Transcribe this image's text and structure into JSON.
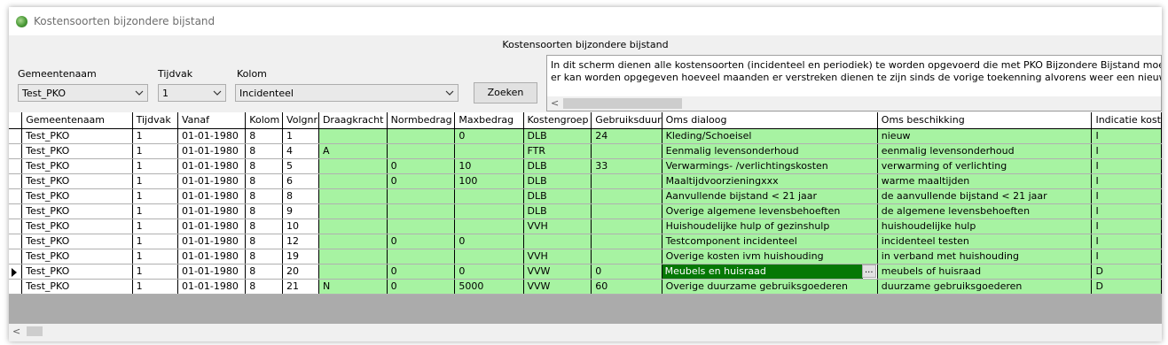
{
  "window": {
    "title": "Kostensoorten bijzondere bijstand"
  },
  "header": {
    "title": "Kostensoorten bijzondere bijstand"
  },
  "filters": {
    "gemeente_label": "Gemeentenaam",
    "gemeente_value": "Test_PKO",
    "tijdvak_label": "Tijdvak",
    "tijdvak_value": "1",
    "kolom_label": "Kolom",
    "kolom_value": "Incidenteel",
    "search_button": "Zoeken"
  },
  "info": {
    "line1": "In dit scherm dienen alle kostensoorten (incidenteel en periodiek) te worden opgevoerd die met PKO Bijzondere Bijstand moeten kunnen worden be",
    "line2": "er kan worden opgegeven hoeveel maanden er verstreken dienen te zijn sinds de vorige toekenning alvorens weer een nieuwe aanvraag voor dez"
  },
  "scroll": {
    "left_arrow": "<"
  },
  "table": {
    "columns": [
      "Gemeentenaam",
      "Tijdvak",
      "Vanaf",
      "Kolom",
      "Volgnr",
      "Draagkracht",
      "Normbedrag",
      "Maxbedrag",
      "Kostengroep",
      "Gebruiksduur",
      "Oms dialoog",
      "Oms beschikking",
      "Indicatie kost"
    ],
    "selected_row": 9,
    "rows": [
      [
        "Test_PKO",
        "1",
        "01-01-1980",
        "8",
        "1",
        "",
        "",
        "0",
        "DLB",
        "24",
        "Kleding/Schoeisel",
        "nieuw",
        "I"
      ],
      [
        "Test_PKO",
        "1",
        "01-01-1980",
        "8",
        "4",
        "A",
        "",
        "",
        "FTR",
        "",
        "Eenmalig levensonderhoud",
        "eenmalig levensonderhoud",
        "I"
      ],
      [
        "Test_PKO",
        "1",
        "01-01-1980",
        "8",
        "5",
        "",
        "0",
        "10",
        "DLB",
        "33",
        "Verwarmings- /verlichtingskosten",
        "verwarming of verlichting",
        "I"
      ],
      [
        "Test_PKO",
        "1",
        "01-01-1980",
        "8",
        "6",
        "",
        "0",
        "100",
        "DLB",
        "",
        "Maaltijdvoorzieningxxx",
        "warme maaltijden",
        "I"
      ],
      [
        "Test_PKO",
        "1",
        "01-01-1980",
        "8",
        "8",
        "",
        "",
        "",
        "DLB",
        "",
        "Aanvullende bijstand < 21 jaar",
        "de aanvullende bijstand < 21 jaar",
        "I"
      ],
      [
        "Test_PKO",
        "1",
        "01-01-1980",
        "8",
        "9",
        "",
        "",
        "",
        "DLB",
        "",
        "Overige algemene levensbehoeften",
        "de algemene levensbehoeften",
        "I"
      ],
      [
        "Test_PKO",
        "1",
        "01-01-1980",
        "8",
        "10",
        "",
        "",
        "",
        "VVH",
        "",
        "Huishoudelijke hulp of gezinshulp",
        "huishoudelijke hulp",
        "I"
      ],
      [
        "Test_PKO",
        "1",
        "01-01-1980",
        "8",
        "12",
        "",
        "0",
        "0",
        "",
        "",
        "Testcomponent incidenteel",
        "incidenteel testen",
        "I"
      ],
      [
        "Test_PKO",
        "1",
        "01-01-1980",
        "8",
        "19",
        "",
        "",
        "",
        "VVH",
        "",
        "Overige kosten ivm huishouding",
        "in verband met huishouding",
        "I"
      ],
      [
        "Test_PKO",
        "1",
        "01-01-1980",
        "8",
        "20",
        "",
        "0",
        "0",
        "VVW",
        "0",
        "Meubels en huisraad",
        "meubels of huisraad",
        "D"
      ],
      [
        "Test_PKO",
        "1",
        "01-01-1980",
        "8",
        "21",
        "N",
        "0",
        "5000",
        "VVW",
        "60",
        "Overige duurzame gebruiksgoederen",
        "duurzame gebruiksgoederen",
        "D"
      ]
    ]
  }
}
